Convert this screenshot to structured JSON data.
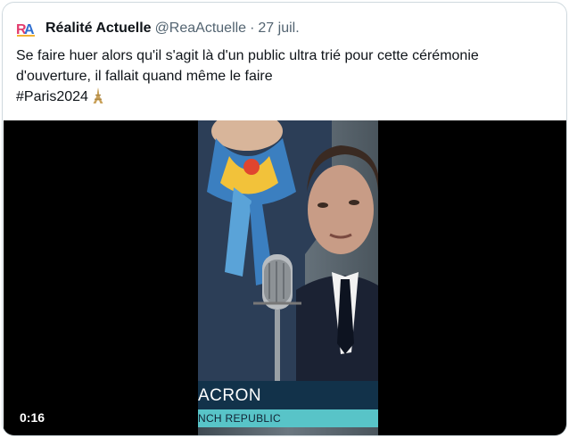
{
  "tweet": {
    "author_name": "Réalité Actuelle",
    "handle": "@ReaActuelle",
    "separator": "·",
    "date": "27 juil.",
    "text_line1": "Se faire huer alors qu'il s'agit là d'un public ultra trié pour cette cérémonie",
    "text_line2": "d'ouverture, il fallait quand même le faire",
    "hashtag": "#Paris2024",
    "emoji_icon": "eiffel-tower-icon"
  },
  "video": {
    "duration": "0:16",
    "overlay_name": "ACRON",
    "overlay_subtitle": "NCH REPUBLIC"
  },
  "colors": {
    "border": "#cfd9de",
    "secondary_text": "#536471",
    "video_bg": "#000000",
    "lower_third_bg": "#12324a",
    "lower_third_accent": "#58c4c8"
  }
}
